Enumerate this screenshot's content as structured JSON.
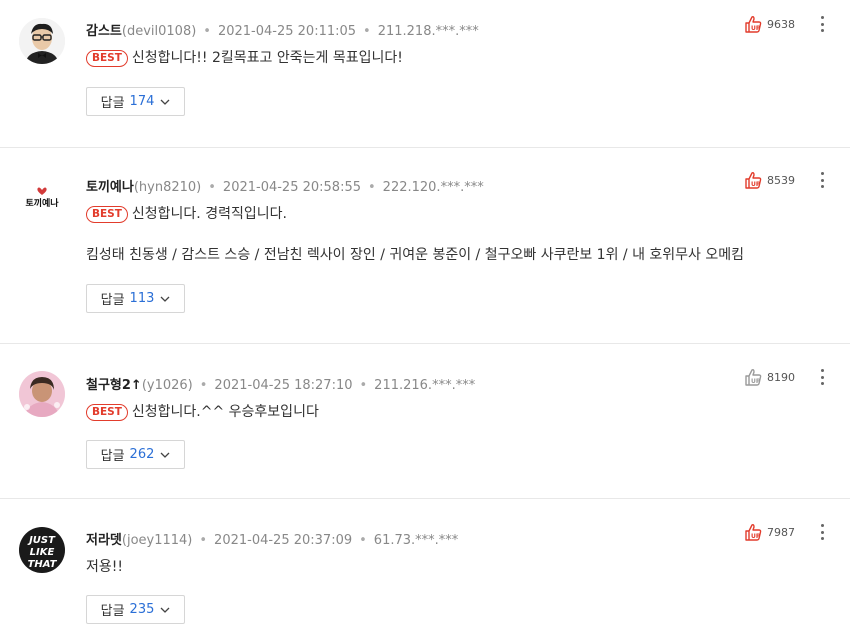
{
  "comments": [
    {
      "nickname": "감스트",
      "user_id": "(devil0108)",
      "datetime": "2021-04-25 20:11:05",
      "ip": "211.218.***.***",
      "badge": "BEST",
      "text": "신청합니다!! 2킬목표고 안죽는게 목표입니다!",
      "extra_text": "",
      "reply_label": "답글",
      "reply_count": "174",
      "likes": "9638",
      "liked": true
    },
    {
      "nickname": "토끼예나",
      "user_id": "(hyn8210)",
      "datetime": "2021-04-25 20:58:55",
      "ip": "222.120.***.***",
      "badge": "BEST",
      "text": "신청합니다.  경력직입니다.",
      "extra_text": "킴성태 친동생 / 감스트 스승 / 전남친 렉사이 장인 / 귀여운 봉준이 / 철구오빠 사쿠란보 1위 / 내 호위무사 오메킴",
      "reply_label": "답글",
      "reply_count": "113",
      "likes": "8539",
      "liked": true
    },
    {
      "nickname": "철구형2↑",
      "user_id": "(y1026)",
      "datetime": "2021-04-25 18:27:10",
      "ip": "211.216.***.***",
      "badge": "BEST",
      "text": "신청합니다.^^ 우승후보입니다",
      "extra_text": "",
      "reply_label": "답글",
      "reply_count": "262",
      "likes": "8190",
      "liked": false
    },
    {
      "nickname": "저라뎃",
      "user_id": "(joey1114)",
      "datetime": "2021-04-25 20:37:09",
      "ip": "61.73.***.***",
      "badge": "",
      "text": "저용!!",
      "extra_text": "",
      "reply_label": "답글",
      "reply_count": "235",
      "likes": "7987",
      "liked": true
    }
  ],
  "avatar_texts": {
    "c2": "토끼예나",
    "c4": "JUST LIKE THAT"
  },
  "colors": {
    "best_red": "#e23c2c",
    "reply_count_blue": "#2b6fd6",
    "like_red": "#e23c2c",
    "like_gray": "#9a9a9a"
  },
  "icons": {
    "like": "thumbs-up-icon",
    "more": "more-vertical-icon",
    "chevron": "chevron-down-icon"
  }
}
